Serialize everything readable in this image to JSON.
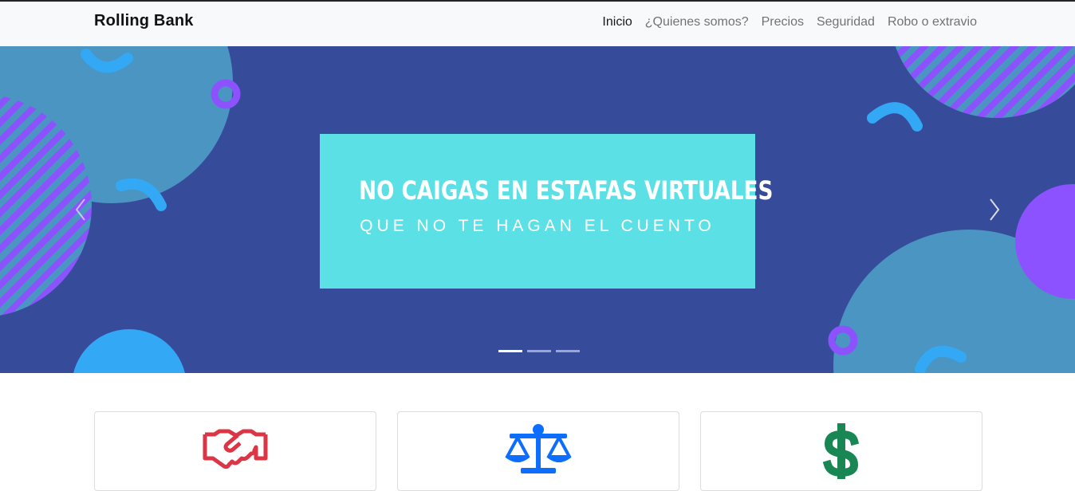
{
  "brand": "Rolling Bank",
  "nav": [
    "Inicio",
    "¿Quienes somos?",
    "Precios",
    "Seguridad",
    "Robo o extravio"
  ],
  "active_nav": "Inicio",
  "carousel": {
    "headline": "NO CAIGAS EN ESTAFAS VIRTUALES",
    "subline": "QUE NO TE HAGAN EL CUENTO",
    "slide_count": 3,
    "active_slide": 1,
    "colors": {
      "background": "#374b9b",
      "banner": "#5be0e6",
      "circle": "#4a95c1",
      "accent_blue": "#33a8f5",
      "accent_purple": "#8c52ff"
    }
  },
  "cards": [
    {
      "icon": "handshake-icon",
      "color": "#dc3545"
    },
    {
      "icon": "balance-scale-icon",
      "color": "#0d6efd"
    },
    {
      "icon": "dollar-sign-icon",
      "color": "#198754"
    }
  ]
}
